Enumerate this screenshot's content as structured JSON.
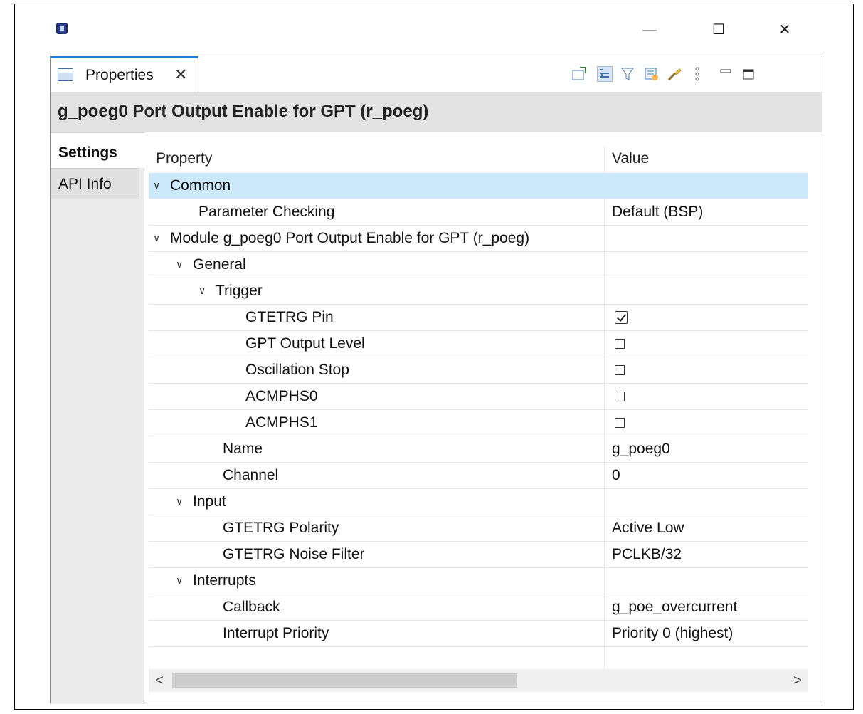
{
  "window": {
    "icon": "renesas-app-icon",
    "minimize_glyph": "—",
    "maximize_glyph": "☐",
    "close_glyph": "✕"
  },
  "view_tab": {
    "label": "Properties",
    "close_glyph": "✕",
    "icon": "properties-table-icon"
  },
  "toolbar": {
    "icons": [
      "pin-view-icon",
      "show-categories-icon",
      "filter-icon",
      "show-advanced-icon",
      "restore-default-icon",
      "view-menu-icon",
      "minimize-view-icon",
      "maximize-view-icon"
    ]
  },
  "page_title": "g_poeg0 Port Output Enable for GPT (r_poeg)",
  "side_tabs": {
    "settings": "Settings",
    "api_info": "API Info"
  },
  "table": {
    "columns": {
      "property": "Property",
      "value": "Value"
    },
    "rows": [
      {
        "label": "Common",
        "level": 0,
        "expandable": true,
        "value": "",
        "selected": true
      },
      {
        "label": "Parameter Checking",
        "level": 2,
        "expandable": false,
        "value": "Default (BSP)"
      },
      {
        "label": "Module g_poeg0 Port Output Enable for GPT (r_poeg)",
        "level": 0,
        "expandable": true,
        "value": ""
      },
      {
        "label": "General",
        "level": 1,
        "expandable": true,
        "value": ""
      },
      {
        "label": "Trigger",
        "level": 2,
        "expandable": true,
        "value": ""
      },
      {
        "label": "GTETRG Pin",
        "level": 4,
        "expandable": false,
        "checkbox": true,
        "checked": true
      },
      {
        "label": "GPT Output Level",
        "level": 4,
        "expandable": false,
        "checkbox": true,
        "checked": false
      },
      {
        "label": "Oscillation Stop",
        "level": 4,
        "expandable": false,
        "checkbox": true,
        "checked": false
      },
      {
        "label": "ACMPHS0",
        "level": 4,
        "expandable": false,
        "checkbox": true,
        "checked": false
      },
      {
        "label": "ACMPHS1",
        "level": 4,
        "expandable": false,
        "checkbox": true,
        "checked": false
      },
      {
        "label": "Name",
        "level": 3,
        "expandable": false,
        "value": "g_poeg0"
      },
      {
        "label": "Channel",
        "level": 3,
        "expandable": false,
        "value": "0"
      },
      {
        "label": "Input",
        "level": 1,
        "expandable": true,
        "value": ""
      },
      {
        "label": "GTETRG Polarity",
        "level": 3,
        "expandable": false,
        "value": "Active Low"
      },
      {
        "label": "GTETRG Noise Filter",
        "level": 3,
        "expandable": false,
        "value": "PCLKB/32"
      },
      {
        "label": "Interrupts",
        "level": 1,
        "expandable": true,
        "value": ""
      },
      {
        "label": "Callback",
        "level": 3,
        "expandable": false,
        "value": "g_poe_overcurrent"
      },
      {
        "label": "Interrupt Priority",
        "level": 3,
        "expandable": false,
        "value": "Priority 0 (highest)"
      }
    ]
  },
  "scrollbar": {
    "left_arrow": "<",
    "right_arrow": ">"
  }
}
